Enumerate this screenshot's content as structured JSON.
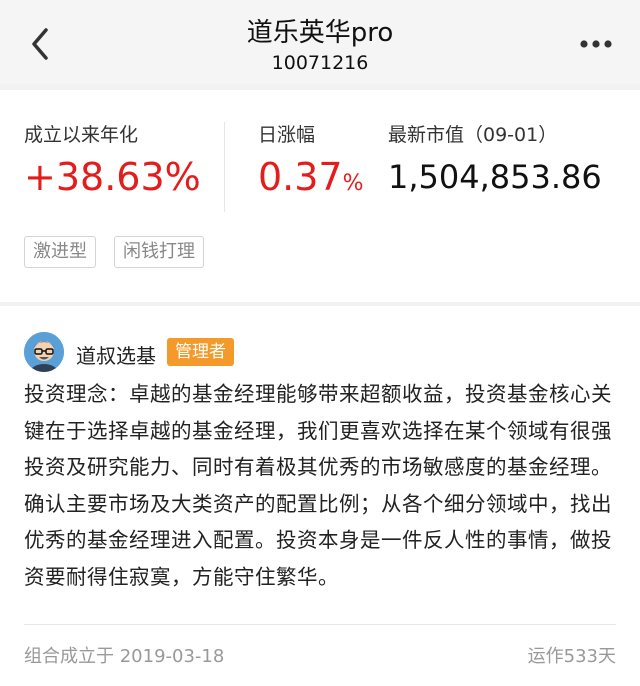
{
  "header": {
    "title": "道乐英华pro",
    "code": "10071216",
    "back_icon": "chevron-left-icon",
    "more_icon": "more-dots-icon"
  },
  "stats": {
    "annualized_label": "成立以来年化",
    "annualized_value": "+38.63%",
    "daily_label": "日涨幅",
    "daily_value": "0.37",
    "daily_pct": "%",
    "market_value_label": "最新市值（09-01）",
    "market_value": "1,504,853.86",
    "tags": [
      "激进型",
      "闲钱打理"
    ],
    "colors": {
      "positive": "#e31c1c"
    }
  },
  "manager": {
    "name": "道叔选基",
    "badge": "管理者",
    "badge_color": "#f39a2a",
    "philosophy": "投资理念：卓越的基金经理能够带来超额收益，投资基金核心关键在于选择卓越的基金经理，我们更喜欢选择在某个领域有很强投资及研究能力、同时有着极其优秀的市场敏感度的基金经理。确认主要市场及大类资产的配置比例；从各个细分领域中，找出优秀的基金经理进入配置。投资本身是一件反人性的事情，做投资要耐得住寂寞，方能守住繁华。"
  },
  "footer": {
    "established": "组合成立于 2019-03-18",
    "running": "运作533天"
  }
}
